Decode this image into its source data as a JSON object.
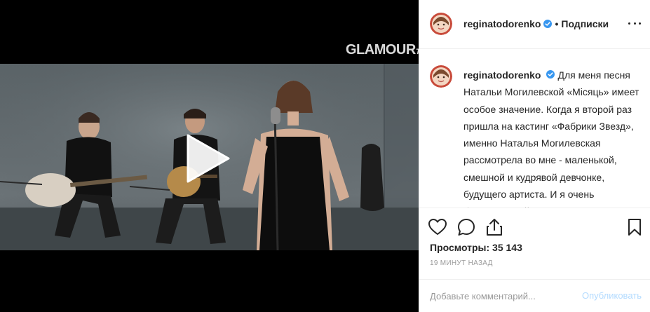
{
  "video": {
    "brand": "GLAMOUR",
    "brand_suffix": "TV",
    "play_icon": "play-icon"
  },
  "header": {
    "username": "reginatodorenko",
    "verified_icon": "verified-badge-icon",
    "separator": "•",
    "follow_label": "Подписки",
    "more_icon": "more-options-icon"
  },
  "caption": {
    "username": "reginatodorenko",
    "text": "Для меня песня Натальи Могилевской «Місяць» имеет особое значение. Когда я второй раз пришла на кастинг «Фабрики Звезд», именно Наталья Могилевская рассмотрела во мне - маленькой, смешной и кудрявой девчонке, будущего артиста. И я очень благодарна ей за то, что она поверила в меня и дала мне этот шанс. И теперь её песню «Місяць» я"
  },
  "actions": {
    "like_icon": "heart-icon",
    "comment_icon": "comment-icon",
    "share_icon": "share-icon",
    "save_icon": "bookmark-icon"
  },
  "stats": {
    "views": "Просмотры: 35 143",
    "time_ago": "19 МИНУТ НАЗАД"
  },
  "comment": {
    "placeholder": "Добавьте комментарий...",
    "publish_label": "Опубликовать"
  },
  "colors": {
    "verified": "#3897f0",
    "publish_disabled": "#b3dbff",
    "muted_text": "#999999"
  }
}
